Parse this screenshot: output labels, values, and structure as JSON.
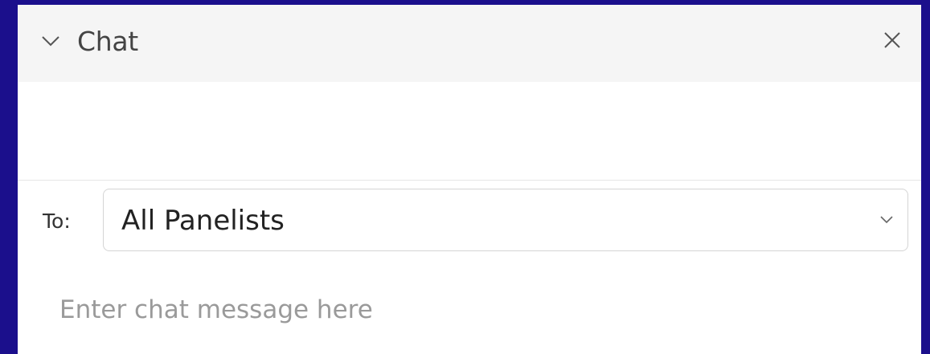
{
  "panel": {
    "title": "Chat",
    "icons": {
      "collapse": "chevron-down-icon",
      "close": "close-icon",
      "dropdown": "chevron-down-icon"
    }
  },
  "recipient": {
    "label": "To:",
    "selected": "All Panelists"
  },
  "compose": {
    "placeholder": "Enter chat message here",
    "value": ""
  },
  "colors": {
    "frame_border": "#1b0f8c",
    "header_bg": "#f5f5f5",
    "text": "#444444",
    "placeholder": "#9a9a9a"
  }
}
